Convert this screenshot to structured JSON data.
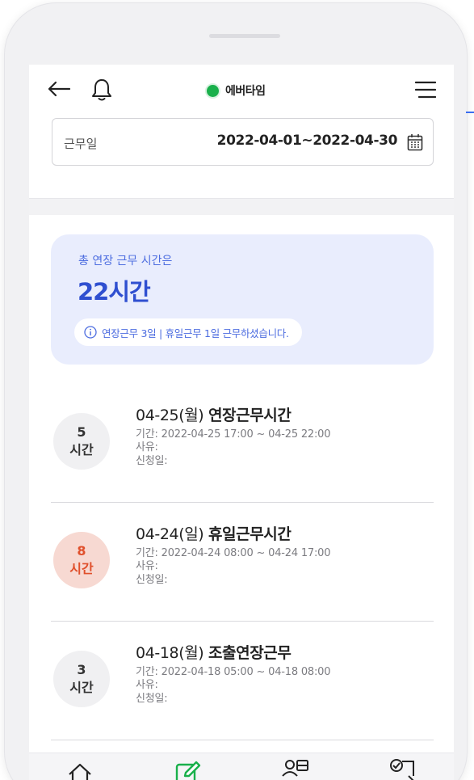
{
  "header": {
    "brand_name": "에버타임",
    "brand_color": "#19b04b",
    "icons": [
      "back-arrow-icon",
      "bell-icon",
      "hamburger-menu-icon"
    ]
  },
  "date_filter": {
    "label": "근무일",
    "value": "2022-04-01~2022-04-30",
    "icon": "calendar-icon"
  },
  "summary": {
    "label": "총 연장 근무 시간은",
    "total": "22시간",
    "detail": "연장근무 3일 | 휴일근무 1일 근무하셨습니다.",
    "info_icon": "info-icon",
    "accent_color": "#2f4fd0",
    "background_color": "#e9edfd"
  },
  "records": [
    {
      "hours": "5",
      "unit": "시간",
      "date": "04-25(월)",
      "title": "연장근무시간",
      "period": "기간: 2022-04-25 17:00 ~ 04-25 22:00",
      "reason": "사유:",
      "applied": "신청일:",
      "highlight": false
    },
    {
      "hours": "8",
      "unit": "시간",
      "date": "04-24(일)",
      "title": "휴일근무시간",
      "period": "기간: 2022-04-24 08:00 ~ 04-24 17:00",
      "reason": "사유:",
      "applied": "신청일:",
      "highlight": true
    },
    {
      "hours": "3",
      "unit": "시간",
      "date": "04-18(월)",
      "title": "조출연장근무",
      "period": "기간: 2022-04-18 05:00 ~ 04-18 08:00",
      "reason": "사유:",
      "applied": "신청일:",
      "highlight": false
    }
  ],
  "tabbar": {
    "icons": [
      "home-icon",
      "edit-icon",
      "contacts-icon",
      "approval-icon"
    ],
    "active_icon": "edit-icon",
    "active_color": "#19b04b"
  }
}
